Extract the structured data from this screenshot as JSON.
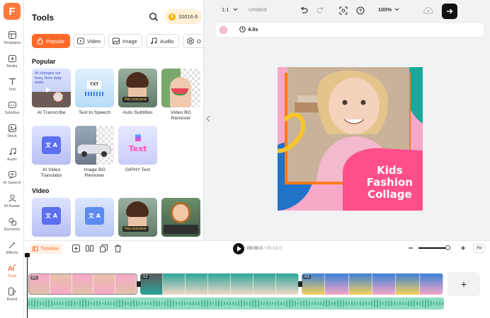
{
  "logo": {
    "letter": "F"
  },
  "rail": [
    {
      "label": "Templates",
      "icon": "layout-icon"
    },
    {
      "label": "Media",
      "icon": "media-plus-icon"
    },
    {
      "label": "Text",
      "icon": "text-icon"
    },
    {
      "label": "Subtitles",
      "icon": "subtitles-icon"
    },
    {
      "label": "Stock",
      "icon": "stock-icon"
    },
    {
      "label": "Audio",
      "icon": "music-icon"
    },
    {
      "label": "AI Speech",
      "icon": "speech-icon"
    },
    {
      "label": "AI Avatar",
      "icon": "avatar-icon"
    },
    {
      "label": "Elements",
      "icon": "elements-icon"
    },
    {
      "label": "Effects",
      "icon": "effects-icon"
    },
    {
      "label": "Tools",
      "icon": "tools-icon",
      "active": true
    },
    {
      "label": "Brand",
      "icon": "brand-icon"
    }
  ],
  "panel": {
    "title": "Tools",
    "coins": "10016.6",
    "coin_symbol": "$",
    "chips": [
      "Popular",
      "Video",
      "Image",
      "Audio",
      "O"
    ],
    "sections": {
      "popular": "Popular",
      "video": "Video"
    },
    "popular_tools": [
      {
        "label": "AI Transcribe",
        "thumb_text": "AI changes our lives, from daily tasks"
      },
      {
        "label": "Text to Speech",
        "thumb_text": "TXT"
      },
      {
        "label": "Auto Subtitles",
        "thumb_text": "Hey everyone"
      },
      {
        "label": "Video BG Remover"
      },
      {
        "label": "AI Video Translator",
        "thumb_text": "文 A"
      },
      {
        "label": "Image BG Remover"
      },
      {
        "label": "GIPHY Text",
        "thumb_text": "Text"
      }
    ],
    "video_tools": [
      {
        "thumb_text": "文 A"
      },
      {
        "thumb_text": "文 A"
      },
      {
        "thumb_text": "Hey everyone"
      },
      {}
    ]
  },
  "topbar": {
    "ratio": "1:1",
    "project_name": "Untitled",
    "zoom": "100%"
  },
  "timebar": {
    "duration": "4.0s"
  },
  "canvas": {
    "title_lines": [
      "Kids",
      "Fashion",
      "Collage"
    ]
  },
  "timeline": {
    "label": "Timeline",
    "current_time": "00:00.0",
    "total_time": "00:13.0",
    "zoom_level": 0.93,
    "fit_label": "Fit",
    "clips": [
      {
        "number": "01"
      },
      {
        "number": "02"
      },
      {
        "number": "03"
      }
    ],
    "add_label": "+"
  },
  "colors": {
    "accent": "#ff6a2b",
    "canvas_bg": "#f7a8c9",
    "canvas_pink_block": "#ff4f8a",
    "canvas_teal": "#1aa89a",
    "canvas_blue": "#1f73c9",
    "canvas_orange": "#ff7a1a",
    "audio": "#8fdcc0"
  }
}
